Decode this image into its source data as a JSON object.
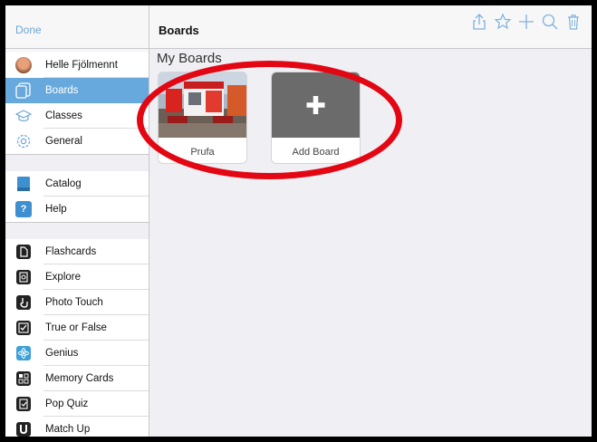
{
  "sidebar": {
    "done_label": "Done",
    "profile": {
      "name": "Helle Fjölmennt"
    },
    "top_items": [
      {
        "label": "Boards",
        "icon": "boards-icon",
        "selected": true
      },
      {
        "label": "Classes",
        "icon": "graduation-cap-icon"
      },
      {
        "label": "General",
        "icon": "gear-icon"
      }
    ],
    "info_items": [
      {
        "label": "Catalog",
        "icon": "book-icon"
      },
      {
        "label": "Help",
        "icon": "question-icon"
      }
    ],
    "mode_items": [
      {
        "label": "Flashcards",
        "icon": "flashcards-icon"
      },
      {
        "label": "Explore",
        "icon": "explore-icon"
      },
      {
        "label": "Photo Touch",
        "icon": "hand-icon"
      },
      {
        "label": "True or False",
        "icon": "checkbox-icon"
      },
      {
        "label": "Genius",
        "icon": "atom-icon"
      },
      {
        "label": "Memory Cards",
        "icon": "grid-icon"
      },
      {
        "label": "Pop Quiz",
        "icon": "quiz-icon"
      },
      {
        "label": "Match Up",
        "icon": "magnet-icon"
      }
    ]
  },
  "header": {
    "title": "Boards"
  },
  "toolbar": {
    "icons": [
      "share-icon",
      "star-icon",
      "plus-icon",
      "search-icon",
      "trash-icon"
    ]
  },
  "main": {
    "section_title": "My Boards",
    "boards": [
      {
        "caption": "Prufa"
      },
      {
        "caption": "Add Board"
      }
    ]
  },
  "colors": {
    "accent": "#67a9dd",
    "annotation": "#e30613"
  }
}
